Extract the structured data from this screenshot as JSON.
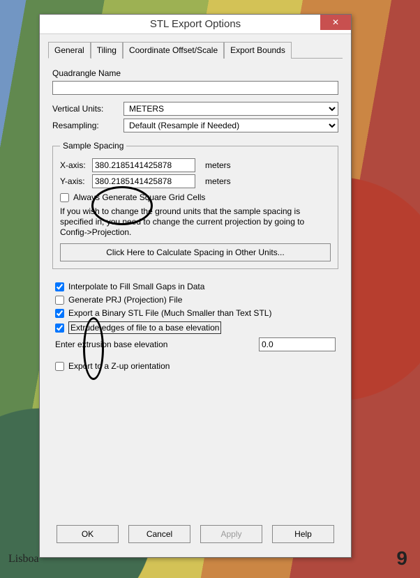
{
  "map": {
    "city_label": "Lisboa",
    "page_number": "9"
  },
  "dialog": {
    "title": "STL Export Options",
    "close_glyph": "✕",
    "tabs": {
      "general": "General",
      "tiling": "Tiling",
      "coord": "Coordinate Offset/Scale",
      "bounds": "Export Bounds"
    },
    "quad_name_label": "Quadrangle Name",
    "quad_name_value": "",
    "vunits_label": "Vertical Units:",
    "vunits_value": "METERS",
    "resamp_label": "Resampling:",
    "resamp_value": "Default (Resample if Needed)",
    "spacing": {
      "legend": "Sample Spacing",
      "x_label": "X-axis:",
      "x_value": "380.2185141425878",
      "y_label": "Y-axis:",
      "y_value": "380.2185141425878",
      "unit": "meters",
      "square_label": "Always Generate Square Grid Cells",
      "note": "If you wish to change the ground units that the sample spacing is specified in, you need to change the current projection by going to Config->Projection.",
      "calc_button": "Click Here to Calculate Spacing in Other Units..."
    },
    "opts": {
      "interp": "Interpolate to Fill Small Gaps in Data",
      "prj": "Generate PRJ (Projection) File",
      "binary": "Export a Binary STL File (Much Smaller than Text STL)",
      "extrude": "Extrude edges of file to a base elevation",
      "ext_label": "Enter extrusion base elevation",
      "ext_value": "0.0",
      "zup": "Export to a Z-up orientation"
    },
    "buttons": {
      "ok": "OK",
      "cancel": "Cancel",
      "apply": "Apply",
      "help": "Help"
    }
  }
}
